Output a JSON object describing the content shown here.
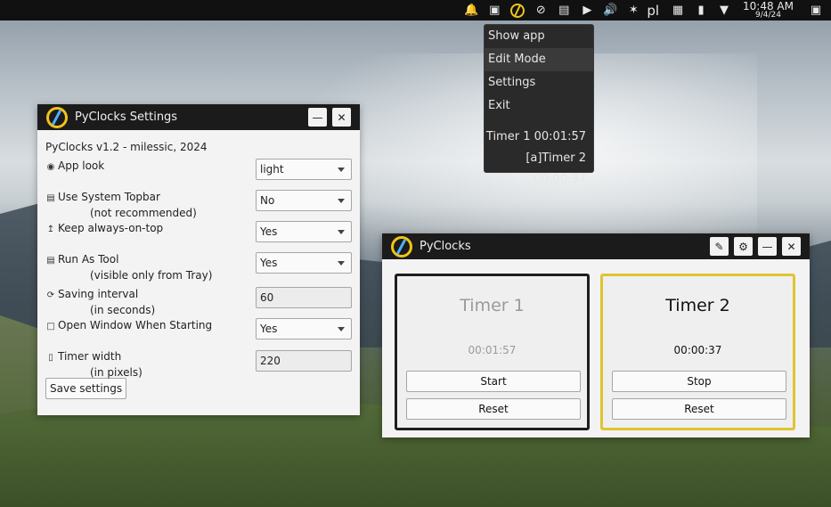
{
  "topbar": {
    "icons": [
      "notification-bell-icon",
      "dropbox-icon",
      "pyclocks-tray-icon",
      "network-off-icon",
      "clipboard-icon",
      "media-play-icon",
      "volume-icon",
      "bluetooth-icon"
    ],
    "keyboard_layout": "pl",
    "clock_time": "10:48 AM",
    "clock_date": "9/4/24"
  },
  "tray_menu": {
    "items": [
      "Show app",
      "Edit Mode",
      "Settings",
      "Exit"
    ],
    "highlighted": "Edit Mode",
    "timers": [
      "Timer 1 00:01:57",
      "[a]Timer 2 00:00:37"
    ]
  },
  "settings_window": {
    "title": "PyClocks Settings",
    "version": "PyClocks v1.2 - milessic, 2024",
    "rows": {
      "app_look": {
        "label": "App look",
        "value": "light"
      },
      "system_topbar": {
        "label": "Use System Topbar",
        "sublabel": "(not recommended)",
        "value": "No"
      },
      "always_on_top": {
        "label": "Keep always-on-top",
        "value": "Yes"
      },
      "run_as_tool": {
        "label": "Run As Tool",
        "sublabel": "(visible only from Tray)",
        "value": "Yes"
      },
      "saving_interval": {
        "label": "Saving interval",
        "sublabel": "(in seconds)",
        "value": "60"
      },
      "open_window": {
        "label": "Open Window When Starting",
        "value": "Yes"
      },
      "timer_width": {
        "label": "Timer width",
        "sublabel": "(in pixels)",
        "value": "220"
      }
    },
    "save_label": "Save settings"
  },
  "clocks_window": {
    "title": "PyClocks",
    "timers": [
      {
        "name": "Timer 1",
        "elapsed": "00:01:57",
        "primary_action": "Start",
        "reset": "Reset",
        "border_color": "#1e1e1e"
      },
      {
        "name": "Timer 2",
        "elapsed": "00:00:37",
        "primary_action": "Stop",
        "reset": "Reset",
        "border_color": "#e0c431"
      }
    ]
  },
  "colors": {
    "accent": "#f0c419",
    "titlebar": "#1b1b1b",
    "active_timer_border": "#e0c431"
  }
}
